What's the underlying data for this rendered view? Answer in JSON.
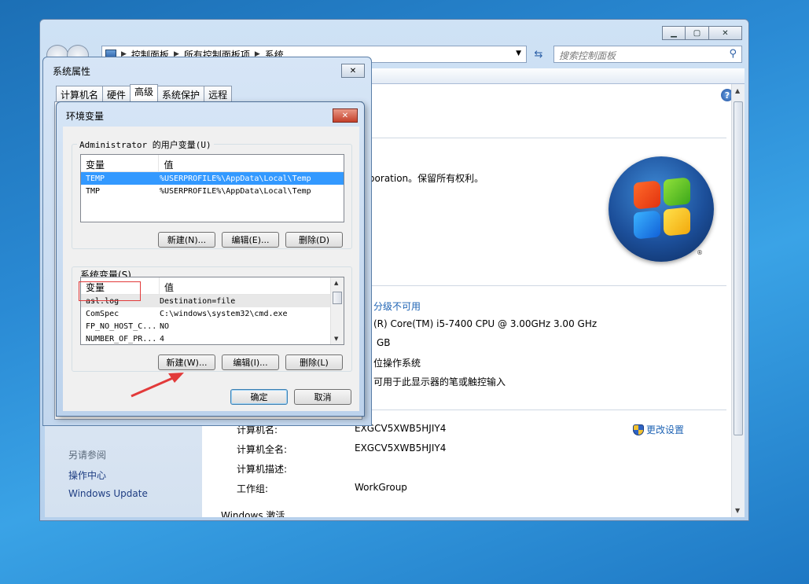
{
  "control_panel": {
    "breadcrumb": [
      "控制面板",
      "所有控制面板项",
      "系统"
    ],
    "search_placeholder": "搜索控制面板",
    "copyright_fragment": "rporation。保留所有权利。",
    "system_lines": [
      {
        "text": "分级不可用",
        "link": true
      },
      {
        "text": "(R) Core(TM) i5-7400 CPU @ 3.00GHz   3.00 GHz",
        "link": false
      },
      {
        "text": "GB",
        "link": false
      },
      {
        "text": "位操作系统",
        "link": false
      },
      {
        "text": "可用于此显示器的笔或触控输入",
        "link": false
      }
    ],
    "computer_info": [
      {
        "label": "计算机名:",
        "value": "EXGCV5XWB5HJIY4"
      },
      {
        "label": "计算机全名:",
        "value": "EXGCV5XWB5HJIY4"
      },
      {
        "label": "计算机描述:",
        "value": ""
      },
      {
        "label": "工作组:",
        "value": "WorkGroup"
      }
    ],
    "change_settings": "更改设置",
    "windows_activation": "Windows 激活",
    "see_also": "另请参阅",
    "left_links": [
      "操作中心",
      "Windows Update"
    ],
    "help_glyph": "?"
  },
  "system_properties": {
    "title": "系统属性",
    "tabs": [
      "计算机名",
      "硬件",
      "高级",
      "系统保护",
      "远程"
    ],
    "active_tab": "高级"
  },
  "env_vars": {
    "title": "环境变量",
    "user_group_label": "Administrator 的用户变量(U)",
    "system_group_label": "系统变量(S)",
    "col_var": "变量",
    "col_val": "值",
    "user_vars": [
      {
        "name": "TEMP",
        "value": "%USERPROFILE%\\AppData\\Local\\Temp",
        "selected": true
      },
      {
        "name": "TMP",
        "value": "%USERPROFILE%\\AppData\\Local\\Temp",
        "selected": false
      }
    ],
    "system_vars": [
      {
        "name": "asl.log",
        "value": "Destination=file"
      },
      {
        "name": "ComSpec",
        "value": "C:\\windows\\system32\\cmd.exe"
      },
      {
        "name": "FP_NO_HOST_C...",
        "value": "NO"
      },
      {
        "name": "NUMBER_OF_PR...",
        "value": "4"
      }
    ],
    "user_buttons": {
      "new": "新建(N)...",
      "edit": "编辑(E)...",
      "delete": "删除(D)"
    },
    "system_buttons": {
      "new": "新建(W)...",
      "edit": "编辑(I)...",
      "delete": "删除(L)"
    },
    "ok": "确定",
    "cancel": "取消"
  },
  "colors": {
    "annotation_red": "#e23a3a",
    "selection_blue": "#3399ff",
    "link_blue": "#1e63b4"
  }
}
